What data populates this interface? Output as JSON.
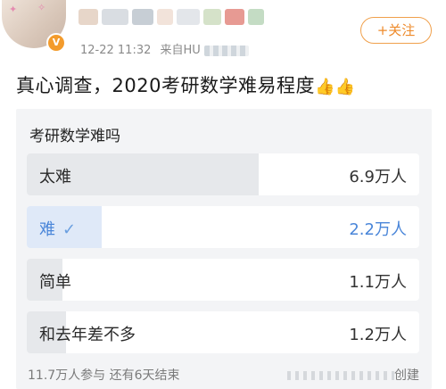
{
  "header": {
    "meta_time": "12-22 11:32",
    "meta_source": "来自HU",
    "follow_label": "+关注"
  },
  "post": {
    "title": "真心调查，2020考研数学难易程度",
    "emoji": "👍👍"
  },
  "poll": {
    "question": "考研数学难吗",
    "options": [
      {
        "label": "太难",
        "count": "6.9万人",
        "ratio": 0.59,
        "selected": false
      },
      {
        "label": "难",
        "count": "2.2万人",
        "ratio": 0.19,
        "selected": true
      },
      {
        "label": "简单",
        "count": "1.1万人",
        "ratio": 0.09,
        "selected": false
      },
      {
        "label": "和去年差不多",
        "count": "1.2万人",
        "ratio": 0.1,
        "selected": false
      }
    ],
    "check_icon": "✓",
    "footer_left": "11.7万人参与   还有6天结束",
    "footer_right": "创建"
  },
  "colors": {
    "fill_default": "#e6e8eb",
    "fill_selected": "#dfe9f8",
    "follow": "#ee8a2a",
    "selected_text": "#4a86d9"
  }
}
